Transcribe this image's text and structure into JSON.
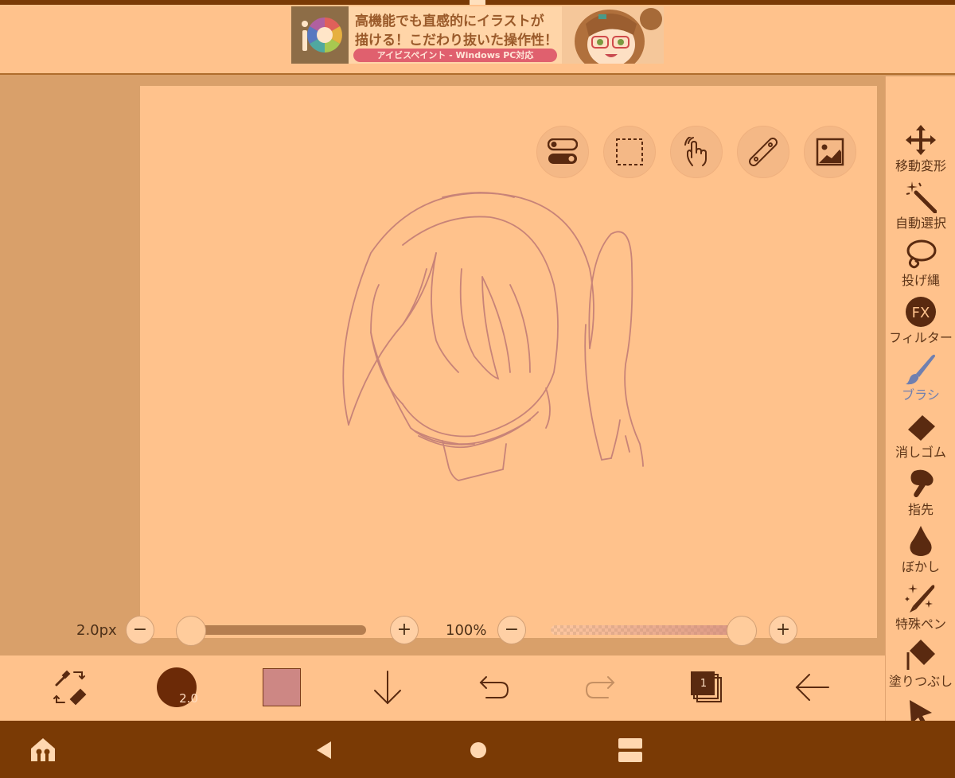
{
  "ad": {
    "line1": "高機能でも直感的にイラストが",
    "line2": "描ける！こだわり抜いた操作性！",
    "pill": "アイビスペイント - Windows PC対応"
  },
  "float_tools": [
    {
      "name": "toggle-icon"
    },
    {
      "name": "selection-rect-icon"
    },
    {
      "name": "touch-gesture-icon"
    },
    {
      "name": "ruler-icon"
    },
    {
      "name": "reference-image-icon"
    }
  ],
  "sliders": {
    "size_label": "2.0px",
    "size_value": 2.0,
    "opacity_label": "100%",
    "opacity_value": 100,
    "minus": "−",
    "plus": "+"
  },
  "toolbar": {
    "brush_size_text": "2.0",
    "color": "#cd8784",
    "layer_count": "1"
  },
  "sidebar": {
    "tools": [
      {
        "label": "移動変形",
        "icon": "move-transform-icon"
      },
      {
        "label": "自動選択",
        "icon": "magic-wand-icon"
      },
      {
        "label": "投げ縄",
        "icon": "lasso-icon"
      },
      {
        "label": "フィルター",
        "icon": "filter-fx-icon"
      },
      {
        "label": "ブラシ",
        "icon": "brush-icon",
        "active": true
      },
      {
        "label": "消しゴム",
        "icon": "eraser-icon"
      },
      {
        "label": "指先",
        "icon": "finger-smudge-icon"
      },
      {
        "label": "ぼかし",
        "icon": "blur-drop-icon"
      },
      {
        "label": "特殊ペン",
        "icon": "special-pen-icon"
      },
      {
        "label": "塗りつぶし",
        "icon": "fill-bucket-icon"
      },
      {
        "label": "",
        "icon": "select-arrow-icon"
      }
    ]
  },
  "colors": {
    "canvas": "#ffc28c",
    "navbar": "#7a3a05",
    "accent_active": "#6f7fb0"
  }
}
